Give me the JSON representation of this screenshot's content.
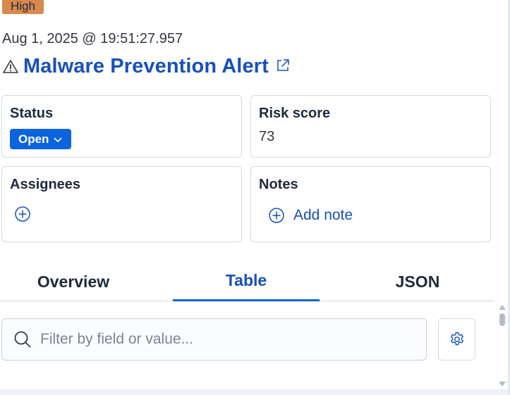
{
  "alert": {
    "severity": "High",
    "timestamp": "Aug 1, 2025 @ 19:51:27.957",
    "title": "Malware Prevention Alert"
  },
  "panels": {
    "status": {
      "title": "Status",
      "value": "Open"
    },
    "risk": {
      "title": "Risk score",
      "value": "73"
    },
    "assignees": {
      "title": "Assignees"
    },
    "notes": {
      "title": "Notes",
      "add_label": "Add note"
    }
  },
  "tabs": [
    {
      "label": "Overview",
      "active": false
    },
    {
      "label": "Table",
      "active": true
    },
    {
      "label": "JSON",
      "active": false
    }
  ],
  "table": {
    "search_placeholder": "Filter by field or value...",
    "search_value": ""
  },
  "colors": {
    "severity_high": "#d8894e",
    "link": "#1750ba",
    "primary": "#0b64dd"
  },
  "icons": [
    "warning-icon",
    "external-link-icon",
    "chevron-down-icon",
    "plus-circle-icon",
    "search-icon",
    "gear-icon"
  ]
}
